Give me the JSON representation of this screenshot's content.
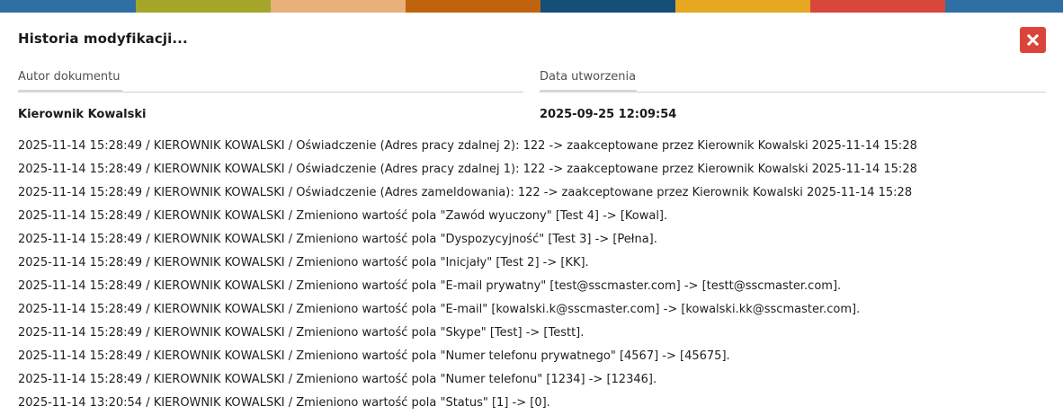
{
  "colors": {
    "strip": [
      "#2f6fa3",
      "#a4a629",
      "#e8b07a",
      "#c0630f",
      "#154f78",
      "#e6a722",
      "#d9473a",
      "#2f6fa3"
    ],
    "close_button": "#d9453a"
  },
  "dialog": {
    "title": "Historia modyfikacji...",
    "close_icon": "close-icon"
  },
  "fields": {
    "author_label": "Autor dokumentu",
    "author_value": "Kierownik Kowalski",
    "created_label": "Data utworzenia",
    "created_value": "2025-09-25 12:09:54"
  },
  "history": [
    "2025-11-14 15:28:49 / KIEROWNIK KOWALSKI / Oświadczenie (Adres pracy zdalnej 2): 122 -> zaakceptowane przez Kierownik Kowalski 2025-11-14 15:28",
    "2025-11-14 15:28:49 / KIEROWNIK KOWALSKI / Oświadczenie (Adres pracy zdalnej 1): 122 -> zaakceptowane przez Kierownik Kowalski 2025-11-14 15:28",
    "2025-11-14 15:28:49 / KIEROWNIK KOWALSKI / Oświadczenie (Adres zameldowania): 122 -> zaakceptowane przez Kierownik Kowalski 2025-11-14 15:28",
    "2025-11-14 15:28:49 / KIEROWNIK KOWALSKI / Zmieniono wartość pola \"Zawód wyuczony\" [Test 4] -> [Kowal].",
    "2025-11-14 15:28:49 / KIEROWNIK KOWALSKI / Zmieniono wartość pola \"Dyspozycyjność\" [Test 3] -> [Pełna].",
    "2025-11-14 15:28:49 / KIEROWNIK KOWALSKI / Zmieniono wartość pola \"Inicjały\" [Test 2] -> [KK].",
    "2025-11-14 15:28:49 / KIEROWNIK KOWALSKI / Zmieniono wartość pola \"E-mail prywatny\" [test@sscmaster.com] -> [testt@sscmaster.com].",
    "2025-11-14 15:28:49 / KIEROWNIK KOWALSKI / Zmieniono wartość pola \"E-mail\" [kowalski.k@sscmaster.com] -> [kowalski.kk@sscmaster.com].",
    "2025-11-14 15:28:49 / KIEROWNIK KOWALSKI / Zmieniono wartość pola \"Skype\" [Test] -> [Testt].",
    "2025-11-14 15:28:49 / KIEROWNIK KOWALSKI / Zmieniono wartość pola \"Numer telefonu prywatnego\" [4567] -> [45675].",
    "2025-11-14 15:28:49 / KIEROWNIK KOWALSKI / Zmieniono wartość pola \"Numer telefonu\" [1234] -> [12346].",
    "2025-11-14 13:20:54 / KIEROWNIK KOWALSKI / Zmieniono wartość pola \"Status\" [1] -> [0]."
  ]
}
